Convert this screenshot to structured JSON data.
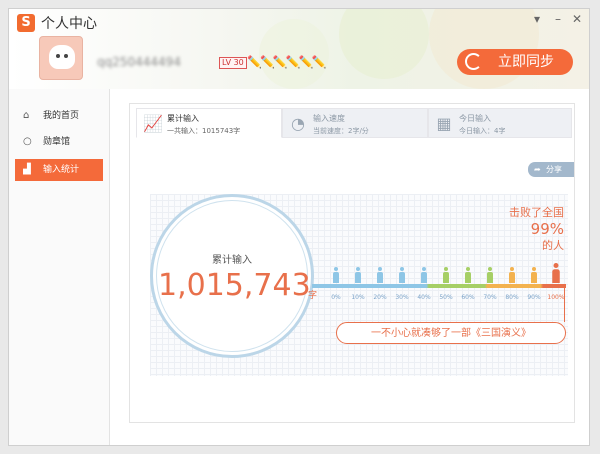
{
  "window": {
    "title": "个人中心",
    "logo_letter": "S",
    "controls": [
      "▾",
      "–",
      "✕"
    ]
  },
  "profile": {
    "username": "qq250444494",
    "level_badge": "LV 30",
    "pens": "✏️✏️✏️✏️✏️✏️",
    "sync_label": "立即同步"
  },
  "sidebar": {
    "items": [
      {
        "label": "我的首页",
        "icon": "⌂"
      },
      {
        "label": "勋章馆",
        "icon": "○"
      },
      {
        "label": "输入统计",
        "icon": "▟"
      }
    ]
  },
  "tabs": [
    {
      "label": "累计输入",
      "sub": "一共输入：1015743字",
      "icon": "📈"
    },
    {
      "label": "输入速度",
      "sub": "当前速度：2字/分",
      "icon": "◔"
    },
    {
      "label": "今日输入",
      "sub": "今日输入：4字",
      "icon": "▦"
    }
  ],
  "share_label": "分享",
  "stats": {
    "circle_label": "累计输入",
    "total": "1,015,743",
    "unit": "字",
    "beat_text": "击败了全国",
    "beat_pct": "99%",
    "beat_people": "的人",
    "quote": "一不小心就凑够了一部《三国演义》"
  },
  "chart_data": {
    "type": "bar",
    "categories": [
      "0%",
      "10%",
      "20%",
      "30%",
      "40%",
      "50%",
      "60%",
      "70%",
      "80%",
      "90%",
      "100%"
    ],
    "values": [],
    "highlight": "99%",
    "colors": [
      "#8ec6e6",
      "#8ec6e6",
      "#8ec6e6",
      "#8ec6e6",
      "#8ec6e6",
      "#a6cf66",
      "#a6cf66",
      "#a6cf66",
      "#f3b24f",
      "#f3b24f",
      "#e8704b"
    ]
  }
}
